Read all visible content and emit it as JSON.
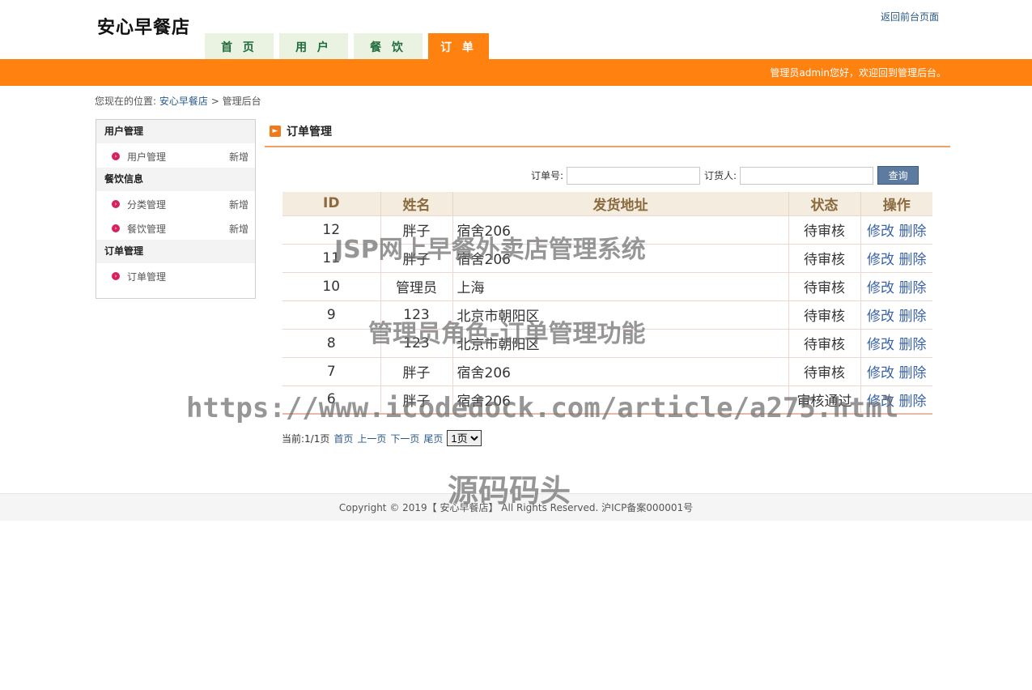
{
  "header": {
    "logo": "安心早餐店",
    "back_link": "返回前台页面",
    "nav": [
      "首 页",
      "用 户",
      "餐 饮",
      "订 单"
    ],
    "welcome": "管理员admin您好，欢迎回到管理后台。"
  },
  "breadcrumb": {
    "prefix": "您现在的位置:",
    "home": "安心早餐店",
    "sep": ">",
    "current": "管理后台"
  },
  "sidebar": {
    "groups": [
      {
        "title": "用户管理",
        "items": [
          {
            "label": "用户管理",
            "add": "新增"
          }
        ]
      },
      {
        "title": "餐饮信息",
        "items": [
          {
            "label": "分类管理",
            "add": "新增"
          },
          {
            "label": "餐饮管理",
            "add": "新增"
          }
        ]
      },
      {
        "title": "订单管理",
        "items": [
          {
            "label": "订单管理"
          }
        ]
      }
    ]
  },
  "main": {
    "title": "订单管理",
    "search": {
      "order_no_label": "订单号:",
      "orderer_label": "订货人:",
      "button": "查询"
    },
    "columns": [
      "ID",
      "姓名",
      "发货地址",
      "状态",
      "操作"
    ],
    "rows": [
      {
        "id": "12",
        "name": "胖子",
        "address": "宿舍206",
        "status": "待审核"
      },
      {
        "id": "11",
        "name": "胖子",
        "address": "宿舍206",
        "status": "待审核"
      },
      {
        "id": "10",
        "name": "管理员",
        "address": "上海",
        "status": "待审核"
      },
      {
        "id": "9",
        "name": "123",
        "address": "北京市朝阳区",
        "status": "待审核"
      },
      {
        "id": "8",
        "name": "123",
        "address": "北京市朝阳区",
        "status": "待审核"
      },
      {
        "id": "7",
        "name": "胖子",
        "address": "宿舍206",
        "status": "待审核"
      },
      {
        "id": "6",
        "name": "胖子",
        "address": "宿舍206",
        "status": "审核通过"
      }
    ],
    "actions": {
      "edit": "修改",
      "delete": "删除"
    },
    "pager": {
      "info": "当前:1/1页",
      "first": "首页",
      "prev": "上一页",
      "next": "下一页",
      "last": "尾页",
      "select": "1页"
    }
  },
  "footer": "Copyright © 2019【 安心早餐店】 All Rights Reserved. 沪ICP备案000001号",
  "watermarks": [
    "JSP网上早餐外卖店管理系统",
    "管理员角色-订单管理功能",
    "https://www.icodedock.com/article/a275.html",
    "源码码头"
  ],
  "colors": {
    "accent": "#ff8110",
    "nav_bg": "#eaf3e2",
    "link": "#2a5a8a",
    "button": "#5d7aa0"
  }
}
